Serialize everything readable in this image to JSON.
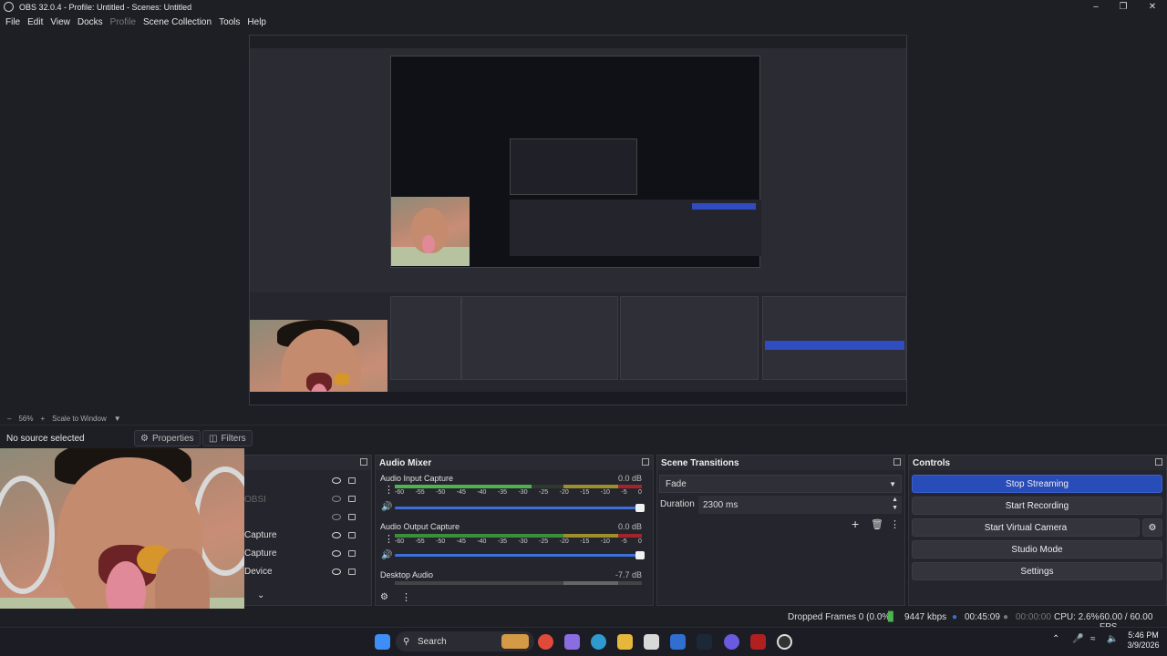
{
  "window": {
    "title": "OBS 32.0.4 - Profile: Untitled - Scenes: Untitled"
  },
  "menu": [
    "File",
    "Edit",
    "View",
    "Docks",
    "Profile",
    "Scene Collection",
    "Tools",
    "Help"
  ],
  "preview_bar": {
    "zoom": "56%",
    "scale_mode": "Scale to Window"
  },
  "source_bar": {
    "no_source": "No source selected",
    "properties": "Properties",
    "filters": "Filters"
  },
  "sources": {
    "rows": [
      "OBSI",
      "Capture",
      "Capture",
      "Device"
    ]
  },
  "audio_mixer": {
    "title": "Audio Mixer",
    "tracks": [
      {
        "name": "Audio Input Capture",
        "db": "0.0 dB"
      },
      {
        "name": "Audio Output Capture",
        "db": "0.0 dB"
      },
      {
        "name": "Desktop Audio",
        "db": "-7.7 dB"
      }
    ],
    "ticks": [
      "-60",
      "-55",
      "-50",
      "-45",
      "-40",
      "-35",
      "-30",
      "-25",
      "-20",
      "-15",
      "-10",
      "-5",
      "0"
    ]
  },
  "transitions": {
    "title": "Scene Transitions",
    "selected": "Fade",
    "duration_label": "Duration",
    "duration_value": "2300 ms"
  },
  "controls": {
    "title": "Controls",
    "stop_streaming": "Stop Streaming",
    "start_recording": "Start Recording",
    "start_virtual_camera": "Start Virtual Camera",
    "studio_mode": "Studio Mode",
    "settings": "Settings"
  },
  "status": {
    "dropped": "Dropped Frames 0 (0.0%)",
    "kbps": "9447 kbps",
    "stream_time": "00:45:09",
    "rec_time": "00:00:00",
    "cpu": "CPU: 2.6%",
    "fps": "60.00 / 60.00 FPS"
  },
  "taskbar": {
    "search": "Search",
    "time": "5:46 PM",
    "date": "3/9/2026"
  },
  "colors": {
    "accent": "#284cb8",
    "bg": "#1e1f25",
    "dock": "#25262d"
  }
}
